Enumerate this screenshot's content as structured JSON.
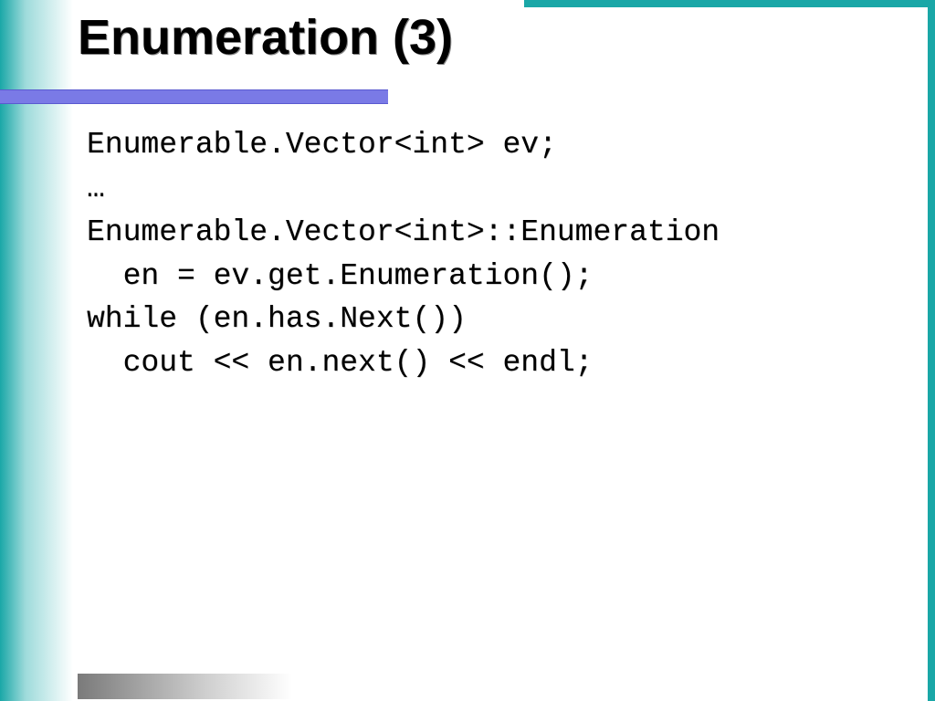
{
  "title": "Enumeration (3)",
  "code": {
    "l1": "Enumerable.Vector<int> ev;",
    "l2": "…",
    "l3": "Enumerable.Vector<int>::Enumeration",
    "l4": "  en = ev.get.Enumeration();",
    "l5": "while (en.has.Next())",
    "l6": "  cout << en.next() << endl;"
  }
}
